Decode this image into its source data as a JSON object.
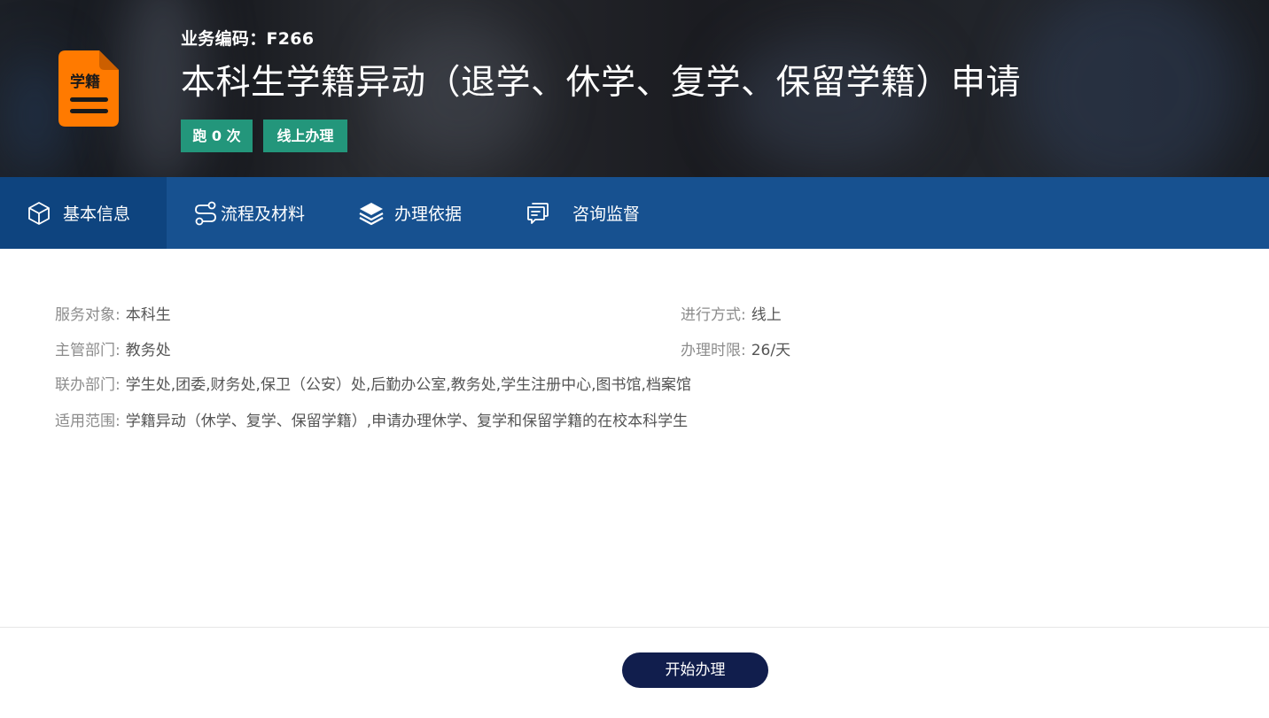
{
  "header": {
    "icon_name": "student-status-document-icon",
    "icon_text": "学籍",
    "icon_color": "#ff7a00",
    "biz_code": "业务编码：F266",
    "title": "本科生学籍异动（退学、休学、复学、保留学籍）申请",
    "tags": [
      "跑 0 次",
      "线上办理"
    ],
    "tag_color": "#23967b"
  },
  "tabs": [
    {
      "label": "基本信息",
      "icon": "cube-icon",
      "active": true
    },
    {
      "label": "流程及材料",
      "icon": "flow-route-icon",
      "active": false
    },
    {
      "label": "办理依据",
      "icon": "layers-icon",
      "active": false
    },
    {
      "label": "咨询监督",
      "icon": "chat-icon",
      "active": false
    }
  ],
  "info": {
    "service_target": {
      "label": "服务对象:",
      "value": "本科生"
    },
    "department": {
      "label": "主管部门:",
      "value": "教务处"
    },
    "joint_departments": {
      "label": "联办部门:",
      "value": "学生处,团委,财务处,保卫（公安）处,后勤办公室,教务处,学生注册中心,图书馆,档案馆"
    },
    "scope": {
      "label": "适用范围:",
      "value": "学籍异动（休学、复学、保留学籍）,申请办理休学、复学和保留学籍的在校本科学生"
    },
    "mode": {
      "label": "进行方式:",
      "value": "线上"
    },
    "time_limit": {
      "label": "办理时限:",
      "value": "26/天"
    }
  },
  "footer": {
    "start_label": "开始办理",
    "button_color": "#111e4d"
  },
  "colors": {
    "tabbar": "#175190",
    "tab_active": "#0e447f"
  }
}
